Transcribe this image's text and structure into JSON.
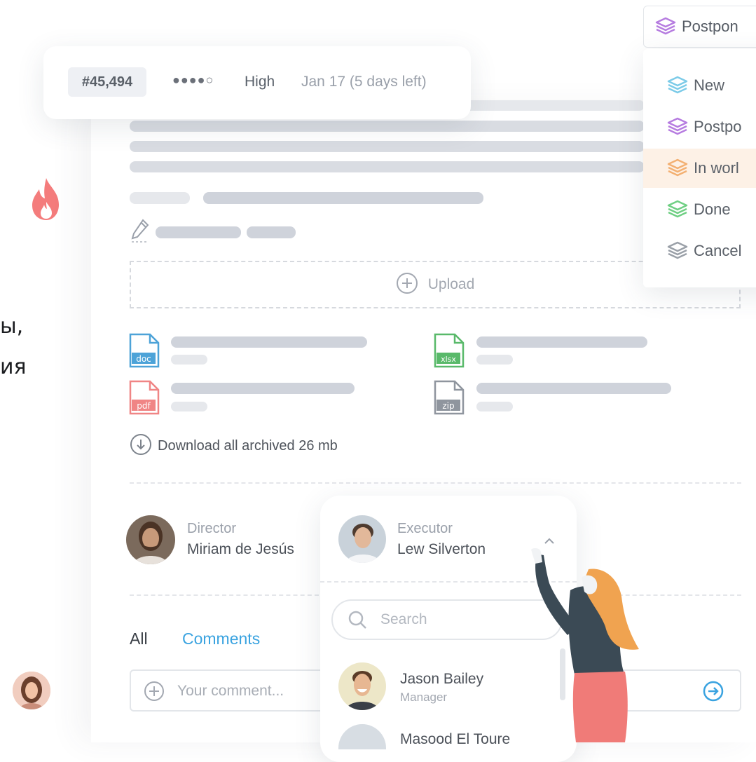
{
  "info": {
    "ticket_id": "#45,494",
    "priority_dots": "●●●●○",
    "priority_label": "High",
    "due_date": "Jan 17 (5 days left)"
  },
  "status": {
    "current": "Postpon",
    "items": [
      {
        "label": "New",
        "color": "#7ccbe8"
      },
      {
        "label": "Postpo",
        "color": "#b67ce0"
      },
      {
        "label": "In worl",
        "color": "#f3b072"
      },
      {
        "label": "Done",
        "color": "#6fcf83"
      },
      {
        "label": "Cancel",
        "color": "#9aa0a8"
      }
    ],
    "current_color": "#b67ce0"
  },
  "upload": {
    "label": "Upload"
  },
  "files": [
    {
      "ext": "doc",
      "color": "#4da3d8"
    },
    {
      "ext": "xlsx",
      "color": "#59b96a"
    },
    {
      "ext": "pdf",
      "color": "#f08585"
    },
    {
      "ext": "zip",
      "color": "#8f959e"
    }
  ],
  "download": {
    "label": "Download all archived 26 mb"
  },
  "director": {
    "role": "Director",
    "name": "Miriam de Jesús"
  },
  "executor": {
    "role": "Executor",
    "name": "Lew Silverton"
  },
  "search": {
    "placeholder": "Search"
  },
  "people_list": [
    {
      "name": "Jason Bailey",
      "role": "Manager"
    },
    {
      "name": "Masood El Toure",
      "role": ""
    }
  ],
  "tabs": {
    "all": "All",
    "comments": "Comments"
  },
  "comment": {
    "placeholder": "Your comment..."
  },
  "side_text": {
    "line1": "ы,",
    "line2": "ия"
  },
  "colors": {
    "accent": "#3aa3e0",
    "fire": "#f47c7c"
  }
}
